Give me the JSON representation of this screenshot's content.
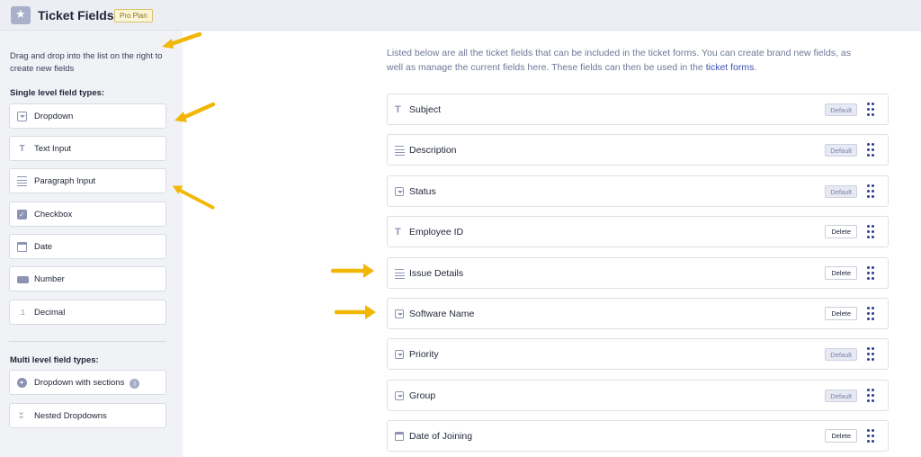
{
  "header": {
    "title": "Ticket Fields",
    "plan_badge": "Pro Plan"
  },
  "sidebar": {
    "help_text": "Drag and drop into the list on the right to create new fields",
    "single_title": "Single level field types:",
    "single_types": [
      {
        "label": "Dropdown",
        "icon": "dropdown-icon"
      },
      {
        "label": "Text Input",
        "icon": "text-icon"
      },
      {
        "label": "Paragraph Input",
        "icon": "paragraph-icon"
      },
      {
        "label": "Checkbox",
        "icon": "checkbox-icon"
      },
      {
        "label": "Date",
        "icon": "calendar-icon"
      },
      {
        "label": "Number",
        "icon": "number-icon"
      },
      {
        "label": "Decimal",
        "icon": "decimal-icon"
      }
    ],
    "multi_title": "Multi level field types:",
    "multi_types": [
      {
        "label": "Dropdown with sections",
        "icon": "dropdown-circle-icon"
      },
      {
        "label": "Nested Dropdowns",
        "icon": "nested-icon"
      }
    ]
  },
  "intro": {
    "text": "Listed below are all the ticket fields that can be included in the ticket forms. You can create brand new fields, as well as manage the current fields here. These fields can then be used in the ",
    "link": "ticket forms",
    "end": "."
  },
  "fields": [
    {
      "name": "Subject",
      "icon": "text-icon",
      "action": "Default"
    },
    {
      "name": "Description",
      "icon": "paragraph-icon",
      "action": "Default"
    },
    {
      "name": "Status",
      "icon": "dropdown-icon",
      "action": "Default"
    },
    {
      "name": "Employee ID",
      "icon": "text-icon",
      "action": "Delete"
    },
    {
      "name": "Issue Details",
      "icon": "paragraph-icon",
      "action": "Delete"
    },
    {
      "name": "Software Name",
      "icon": "dropdown-icon",
      "action": "Delete"
    },
    {
      "name": "Priority",
      "icon": "dropdown-icon",
      "action": "Default"
    },
    {
      "name": "Group",
      "icon": "dropdown-icon",
      "action": "Default"
    },
    {
      "name": "Date of Joining",
      "icon": "calendar-icon",
      "action": "Delete"
    }
  ],
  "colors": {
    "accent": "#3d4fb5",
    "arrow": "#f2b705",
    "sidebar_bg": "#f1f2f6"
  }
}
